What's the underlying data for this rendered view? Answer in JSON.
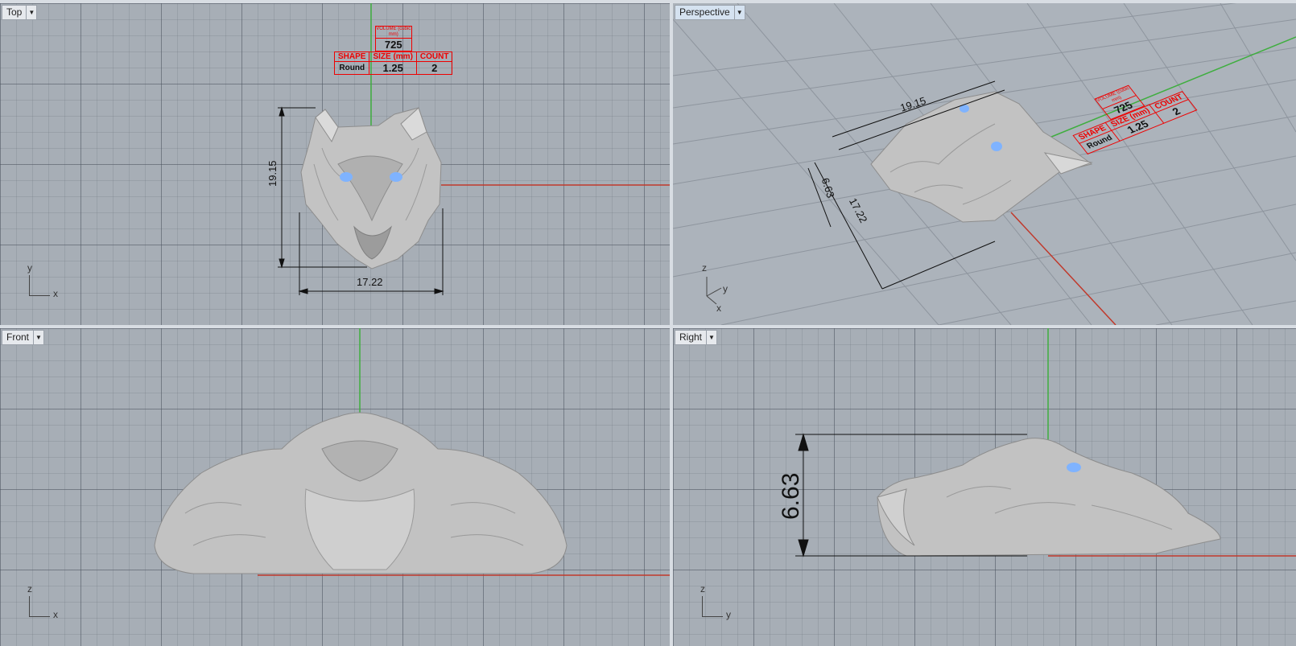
{
  "viewports": {
    "top": {
      "label": "Top",
      "axis_x": "x",
      "axis_y": "y"
    },
    "perspective": {
      "label": "Perspective",
      "axis_x": "x",
      "axis_y": "y",
      "axis_z": "z"
    },
    "front": {
      "label": "Front",
      "axis_x": "x",
      "axis_y": "z"
    },
    "right": {
      "label": "Right",
      "axis_x": "y",
      "axis_y": "z"
    }
  },
  "dimensions": {
    "height": "19.15",
    "width": "17.22",
    "depth": "6.63"
  },
  "stone_table": {
    "volume_header": "VOLUME (cubic mm)",
    "volume_value": "725",
    "headers": [
      "SHAPE",
      "SIZE (mm)",
      "COUNT"
    ],
    "row": [
      "Round",
      "1.25",
      "2"
    ]
  },
  "colors": {
    "grid_bg": "#a7aeb6",
    "x_axis": "#c0392b",
    "y_axis": "#3fae3f",
    "stone": "#7fb3ff",
    "model": "#c8c8c8",
    "annotation": "#e00000"
  },
  "icons": {
    "dropdown": "triangle-down"
  }
}
